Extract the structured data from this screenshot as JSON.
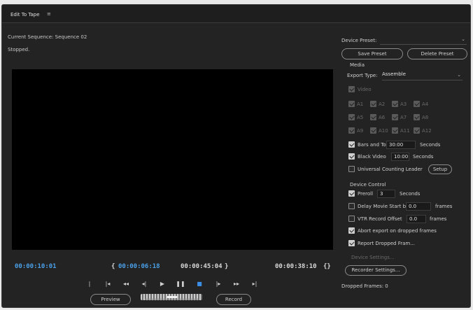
{
  "window": {
    "title": "Edit To Tape",
    "menu_icon": "menu-icon"
  },
  "status": {
    "sequence": "Current Sequence: Sequence 02",
    "state": "Stopped."
  },
  "timecodes": {
    "current": "00:00:10:01",
    "in": "00:00:06:18",
    "out": "00:00:45:04",
    "duration": "00:00:38:10"
  },
  "timecode_marks": {
    "in_bracket": "{",
    "out_bracket": "}",
    "duration_icon": "{}"
  },
  "transport": {
    "icons": [
      "marker-icon",
      "go-to-in-icon",
      "rewind-icon",
      "step-back-icon",
      "play-icon",
      "pause-icon",
      "stop-icon",
      "step-forward-icon",
      "fast-forward-icon",
      "go-to-out-icon"
    ],
    "glyphs": [
      "|",
      "|◂",
      "◂◂",
      "◂|",
      "▶",
      "❚❚",
      "■",
      "|▸",
      "▸▸",
      "▸|"
    ]
  },
  "buttons": {
    "preview": "Preview",
    "record": "Record",
    "save_preset": "Save Preset",
    "delete_preset": "Delete Preset",
    "setup": "Setup",
    "device_settings": "Device Settings...",
    "recorder_settings": "Recorder Settings..."
  },
  "preset": {
    "label": "Device Preset:",
    "value": ""
  },
  "media": {
    "section": "Media",
    "export_type_label": "Export Type:",
    "export_type_value": "Assemble",
    "video_label": "Video",
    "audio": [
      "A1",
      "A2",
      "A3",
      "A4",
      "A5",
      "A6",
      "A7",
      "A8",
      "A9",
      "A10",
      "A11",
      "A12"
    ],
    "bars_and_tone_label": "Bars and Tone",
    "bars_and_tone_value": "30:00",
    "black_video_label": "Black Video",
    "black_video_value": "10:00",
    "seconds_unit": "Seconds",
    "universal_leader_label": "Universal Counting Leader"
  },
  "device_control": {
    "section": "Device Control",
    "preroll_label": "Preroll",
    "preroll_value": "3",
    "seconds_unit": "Seconds",
    "delay_label": "Delay Movie Start by",
    "delay_value": "0.0",
    "vtr_label": "VTR Record Offset",
    "vtr_value": "0.0",
    "frames_unit": "frames",
    "abort_label": "Abort export on dropped frames",
    "report_label": "Report Dropped Fram..."
  },
  "dropped_frames": "Dropped Frames: 0"
}
